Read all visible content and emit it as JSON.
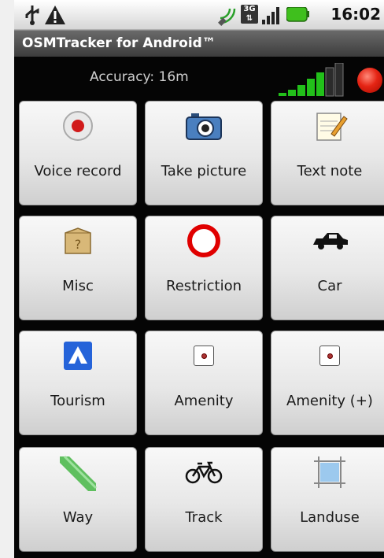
{
  "status": {
    "time": "16:02",
    "network": "3G"
  },
  "app": {
    "title": "OSMTracker for Android™"
  },
  "gps": {
    "accuracy_text": "Accuracy: 16m"
  },
  "buttons": [
    {
      "label": "Voice record",
      "icon": "voice-record-icon"
    },
    {
      "label": "Take picture",
      "icon": "camera-icon"
    },
    {
      "label": "Text note",
      "icon": "notepad-icon"
    },
    {
      "label": "Misc",
      "icon": "box-icon"
    },
    {
      "label": "Restriction",
      "icon": "restriction-icon"
    },
    {
      "label": "Car",
      "icon": "car-icon"
    },
    {
      "label": "Tourism",
      "icon": "tent-icon"
    },
    {
      "label": "Amenity",
      "icon": "amenity-icon"
    },
    {
      "label": "Amenity (+)",
      "icon": "amenity-plus-icon"
    },
    {
      "label": "Way",
      "icon": "way-icon"
    },
    {
      "label": "Track",
      "icon": "bicycle-icon"
    },
    {
      "label": "Landuse",
      "icon": "landuse-icon"
    }
  ],
  "colors": {
    "signal_green": "#22c01a",
    "record_red": "#e52414",
    "tent_blue": "#2563d9"
  }
}
